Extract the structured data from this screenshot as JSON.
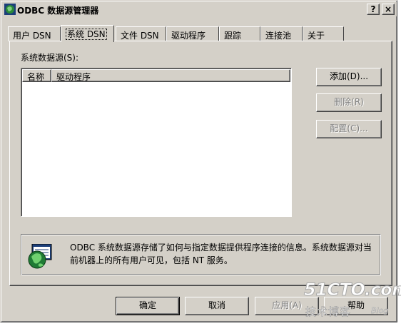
{
  "window": {
    "title": "ODBC 数据源管理器",
    "help_label": "?",
    "close_label": "×"
  },
  "tabs": [
    {
      "label": "用户 DSN"
    },
    {
      "label": "系统 DSN"
    },
    {
      "label": "文件 DSN"
    },
    {
      "label": "驱动程序"
    },
    {
      "label": "跟踪"
    },
    {
      "label": "连接池"
    },
    {
      "label": "关于"
    }
  ],
  "active_tab": "系统 DSN",
  "panel": {
    "list_label": "系统数据源(S):",
    "columns": [
      "名称",
      "驱动程序"
    ],
    "rows": [],
    "buttons": {
      "add": "添加(D)...",
      "remove": "删除(R)",
      "configure": "配置(C)..."
    },
    "info_text": "ODBC 系统数据源存储了如何与指定数据提供程序连接的信息。系统数据源对当前机器上的所有用户可见，包括 NT 服务。"
  },
  "footer": {
    "ok": "确定",
    "cancel": "取消",
    "apply": "应用(A)",
    "help": "帮助"
  },
  "watermark": {
    "logo": "51CTO.com",
    "subtitle": "技术博客",
    "blog": "Blog"
  }
}
